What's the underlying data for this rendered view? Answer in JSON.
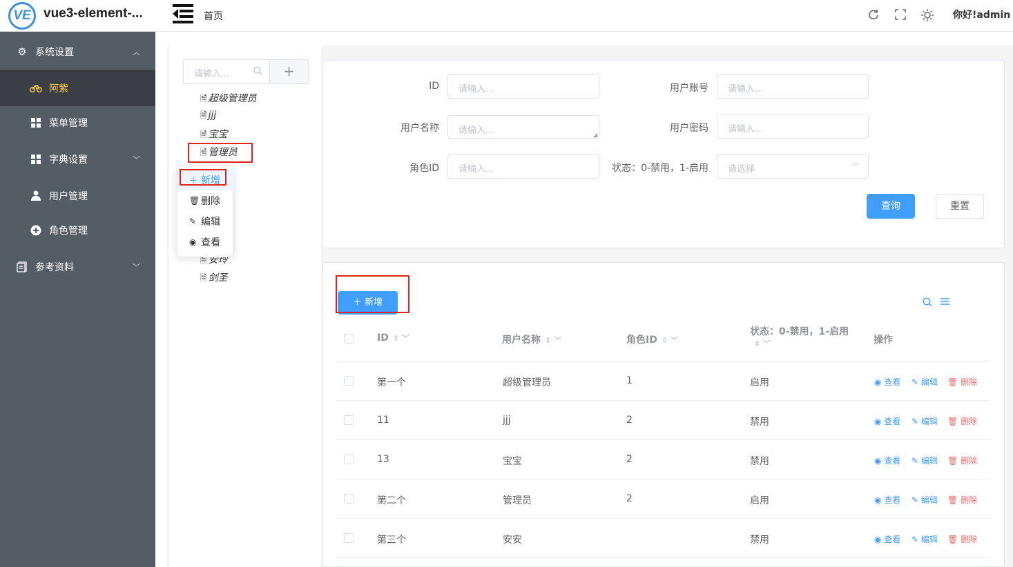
{
  "header": {
    "logo_badge": "VE",
    "app_title": "vue3-element-...",
    "breadcrumb": "首页",
    "greeting": "你好!admin",
    "icons": [
      "refresh-icon",
      "fullscreen-icon",
      "theme-icon"
    ]
  },
  "sidebar": {
    "items": [
      {
        "label": "系统设置",
        "icon": "gear-icon",
        "arrow": "︿"
      },
      {
        "label": "阿紫",
        "icon": "bike-icon"
      },
      {
        "label": "菜单管理",
        "icon": "grid-icon"
      },
      {
        "label": "字典设置",
        "icon": "grid-icon",
        "arrow": "﹀"
      },
      {
        "label": "用户管理",
        "icon": "user-icon"
      },
      {
        "label": "角色管理",
        "icon": "role-icon"
      },
      {
        "label": "参考资料",
        "icon": "doc-icon",
        "arrow": "﹀"
      }
    ],
    "active_color": "#ffd04b"
  },
  "tree": {
    "search_placeholder": "请输入...",
    "nodes": [
      "超级管理员",
      "jjj",
      "宝宝",
      "管理员",
      "安玲",
      "剑圣"
    ],
    "context_menu": [
      "新增",
      "删除",
      "编辑",
      "查看"
    ]
  },
  "form": {
    "fields": [
      {
        "label": "ID",
        "placeholder": "请输入..."
      },
      {
        "label": "用户账号",
        "placeholder": "请输入..."
      },
      {
        "label": "用户名称",
        "placeholder": "请输入..."
      },
      {
        "label": "用户密码",
        "placeholder": "请输入..."
      },
      {
        "label": "角色ID",
        "placeholder": "请输入..."
      },
      {
        "label": "状态：0-禁用，1-启用",
        "placeholder": "请选择"
      }
    ],
    "query_label": "查询",
    "reset_label": "重置"
  },
  "table": {
    "add_label": "新增",
    "columns": [
      "ID",
      "用户名称",
      "角色ID",
      "状态：0-禁用，1-启用",
      "操作"
    ],
    "rows": [
      {
        "id": "第一个",
        "name": "超级管理员",
        "role": "1",
        "status": "启用"
      },
      {
        "id": "11",
        "name": "jjj",
        "role": "2",
        "status": "禁用"
      },
      {
        "id": "13",
        "name": "宝宝",
        "role": "2",
        "status": "禁用"
      },
      {
        "id": "第二个",
        "name": "管理员",
        "role": "2",
        "status": "启用"
      },
      {
        "id": "第三个",
        "name": "安安",
        "role": "",
        "status": "禁用"
      }
    ],
    "actions": {
      "view": "查看",
      "edit": "编辑",
      "delete": "删除"
    }
  },
  "colors": {
    "primary": "#409eff",
    "danger": "#f56c6c",
    "sidebar": "#545c64",
    "highlight": "#e0241a"
  }
}
